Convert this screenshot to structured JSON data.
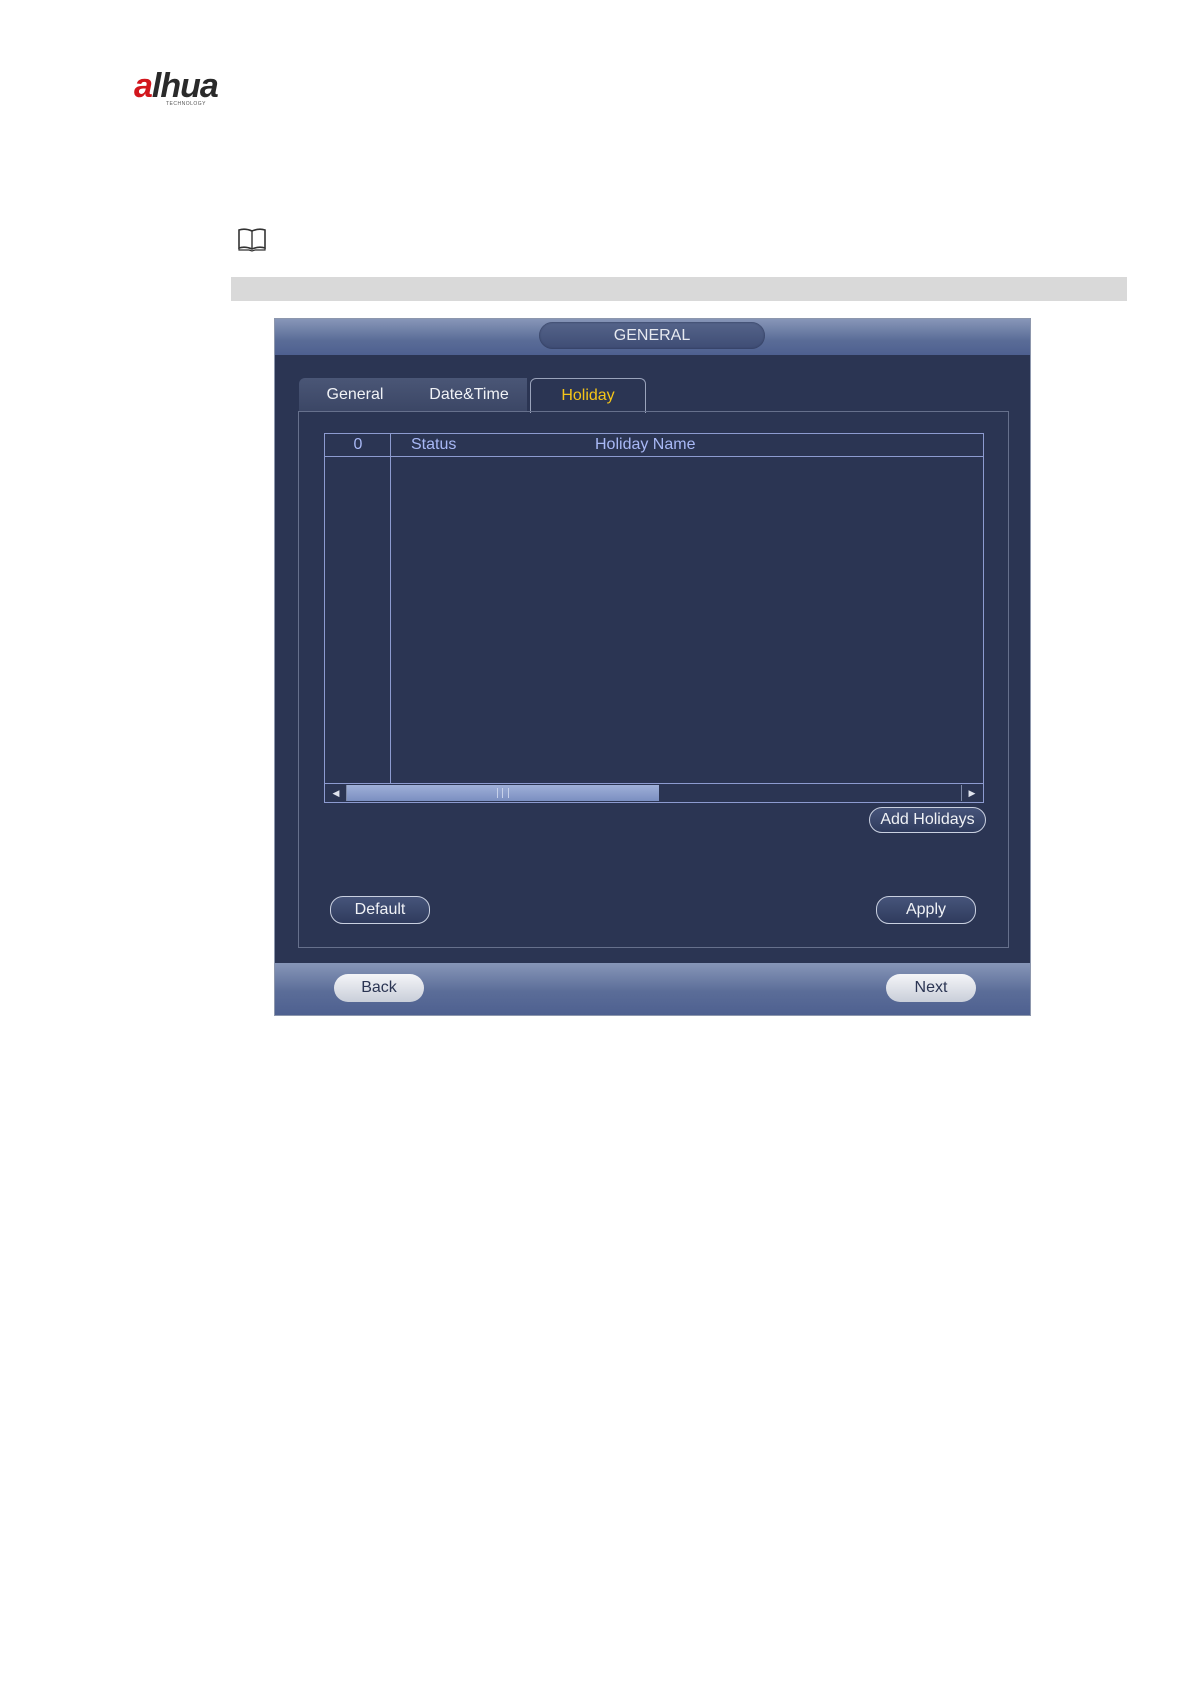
{
  "logo": {
    "brand": "alhua",
    "brand_first": "a",
    "brand_rest": "lhua",
    "tagline": "TECHNOLOGY"
  },
  "note_icon": "open-book-icon",
  "dialog": {
    "title": "GENERAL",
    "tabs": [
      {
        "label": "General",
        "active": false
      },
      {
        "label": "Date&Time",
        "active": false
      },
      {
        "label": "Holiday",
        "active": true
      }
    ],
    "table": {
      "columns": [
        "0",
        "Status",
        "Holiday Name"
      ],
      "rows": []
    },
    "add_button": "Add Holidays",
    "default_button": "Default",
    "apply_button": "Apply",
    "back_button": "Back",
    "next_button": "Next",
    "scroll_left_icon": "triangle-left-icon",
    "scroll_right_icon": "triangle-right-icon"
  },
  "colors": {
    "dialog_bg": "#2b3553",
    "active_tab_text": "#f5c518",
    "header_text": "#a8b8f5",
    "brand_red": "#d2161d"
  }
}
